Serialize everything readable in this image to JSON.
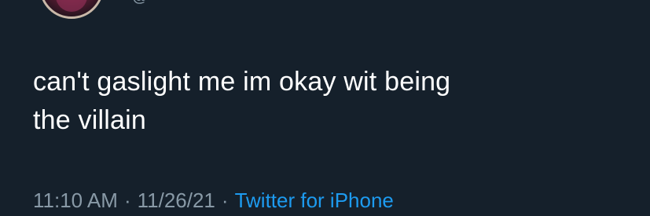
{
  "tweet": {
    "handle": "@",
    "text": "can't gaslight me im okay wit being\nthe villain",
    "time": "11:10 AM",
    "separator": "·",
    "date": "11/26/21",
    "source": "Twitter for iPhone"
  },
  "colors": {
    "background": "#15202b",
    "text": "#ffffff",
    "secondary": "#8899a6",
    "link": "#1d9bf0"
  }
}
